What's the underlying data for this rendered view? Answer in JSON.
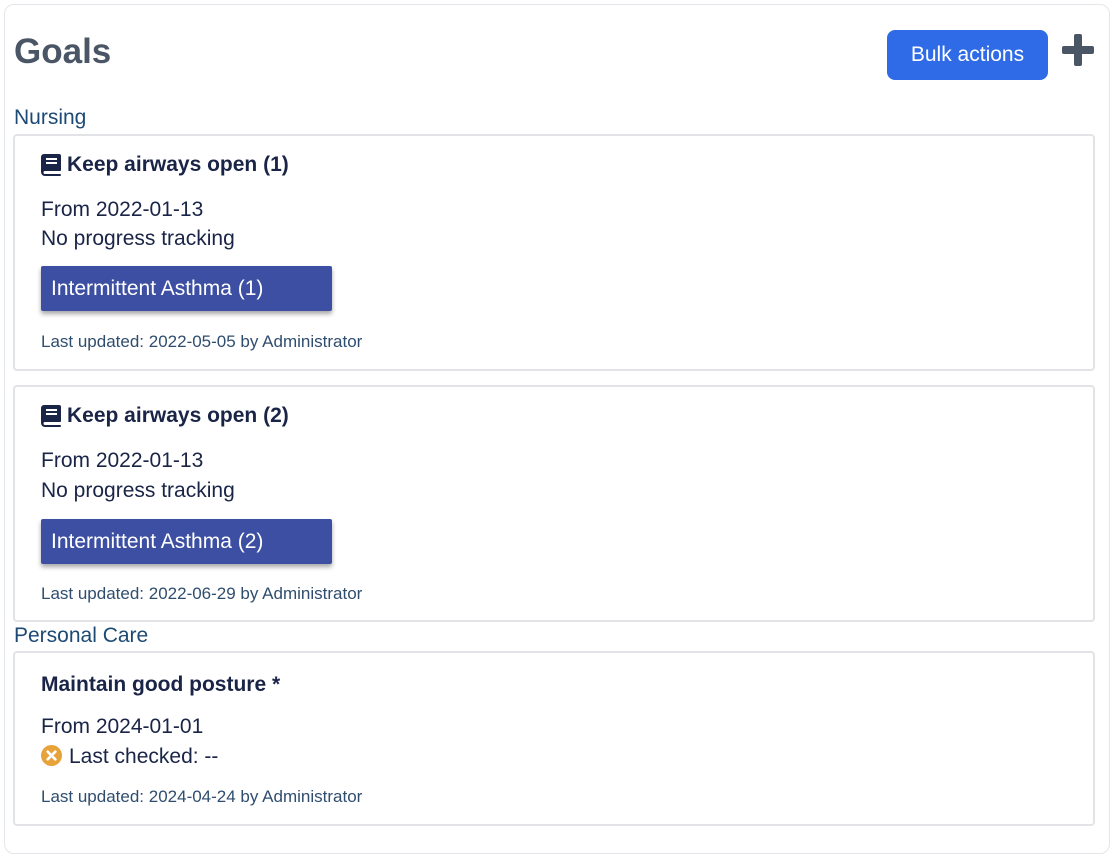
{
  "header": {
    "title": "Goals",
    "bulk_actions_label": "Bulk actions",
    "add_icon": "plus-icon"
  },
  "colors": {
    "primary": "#2f6be6",
    "chip": "#3d4fa3",
    "section": "#1d4a74",
    "warning": "#e8a23a"
  },
  "sections": [
    {
      "label": "Nursing",
      "goals": [
        {
          "icon": "book-icon",
          "title": "Keep airways open (1)",
          "from": "From 2022-01-13",
          "progress": "No progress tracking",
          "chip": "Intermittent Asthma (1)",
          "updated": "Last updated: 2022-05-05 by Administrator"
        },
        {
          "icon": "book-icon",
          "title": "Keep airways open (2)",
          "from": "From 2022-01-13",
          "progress": "No progress tracking",
          "chip": "Intermittent Asthma (2)",
          "updated": "Last updated: 2022-06-29 by Administrator"
        }
      ]
    },
    {
      "label": "Personal Care",
      "goals": [
        {
          "title": "Maintain good posture *",
          "from": "From 2024-01-01",
          "status_icon": "x-circle-icon",
          "progress": "Last checked: --",
          "updated": "Last updated: 2024-04-24 by Administrator"
        }
      ]
    }
  ]
}
